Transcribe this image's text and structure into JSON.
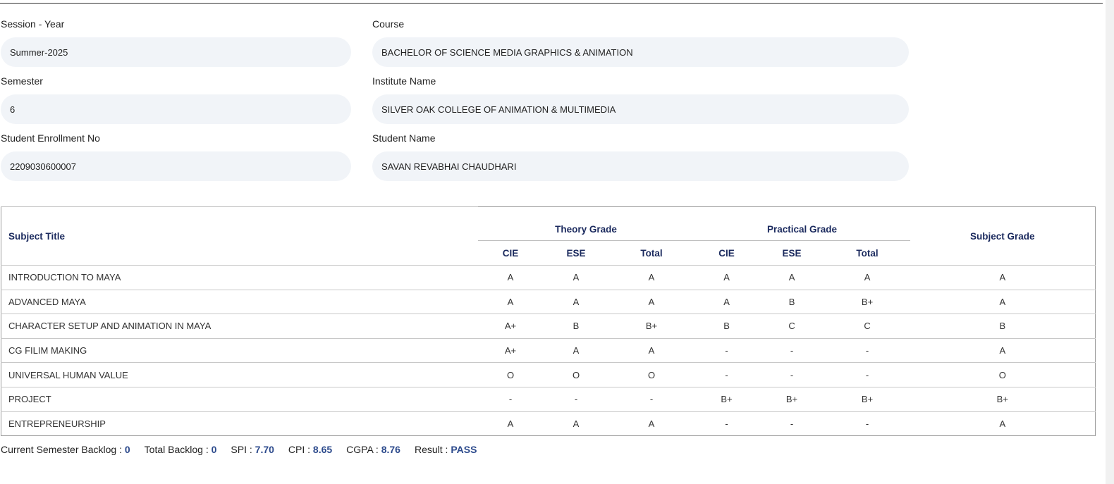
{
  "fields": {
    "session_year": {
      "label": "Session - Year",
      "value": "Summer-2025"
    },
    "course": {
      "label": "Course",
      "value": "BACHELOR OF SCIENCE MEDIA GRAPHICS & ANIMATION"
    },
    "semester": {
      "label": "Semester",
      "value": "6"
    },
    "institute": {
      "label": "Institute Name",
      "value": "SILVER OAK COLLEGE OF ANIMATION & MULTIMEDIA"
    },
    "enrollment": {
      "label": "Student Enrollment No",
      "value": "2209030600007"
    },
    "student_name": {
      "label": "Student Name",
      "value": "SAVAN REVABHAI CHAUDHARI"
    }
  },
  "table": {
    "headers": {
      "subject_title": "Subject Title",
      "theory_grade": "Theory Grade",
      "practical_grade": "Practical Grade",
      "subject_grade": "Subject Grade",
      "sub_cols": [
        "CIE",
        "ESE",
        "Total",
        "CIE",
        "ESE",
        "Total"
      ]
    },
    "rows": [
      [
        "INTRODUCTION TO MAYA",
        "A",
        "A",
        "A",
        "A",
        "A",
        "A",
        "A"
      ],
      [
        "ADVANCED MAYA",
        "A",
        "A",
        "A",
        "A",
        "B",
        "B+",
        "A"
      ],
      [
        "CHARACTER SETUP AND ANIMATION IN MAYA",
        "A+",
        "B",
        "B+",
        "B",
        "C",
        "C",
        "B"
      ],
      [
        "CG FILIM MAKING",
        "A+",
        "A",
        "A",
        "-",
        "-",
        "-",
        "A"
      ],
      [
        "UNIVERSAL HUMAN VALUE",
        "O",
        "O",
        "O",
        "-",
        "-",
        "-",
        "O"
      ],
      [
        "PROJECT",
        "-",
        "-",
        "-",
        "B+",
        "B+",
        "B+",
        "B+"
      ],
      [
        "ENTREPRENEURSHIP",
        "A",
        "A",
        "A",
        "-",
        "-",
        "-",
        "A"
      ]
    ]
  },
  "summary": {
    "current_backlog": {
      "label": "Current Semester Backlog :",
      "value": "0"
    },
    "total_backlog": {
      "label": "Total Backlog :",
      "value": "0"
    },
    "spi": {
      "label": "SPI :",
      "value": "7.70"
    },
    "cpi": {
      "label": "CPI :",
      "value": "8.65"
    },
    "cgpa": {
      "label": "CGPA :",
      "value": "8.76"
    },
    "result": {
      "label": "Result :",
      "value": "PASS"
    }
  },
  "colors": {
    "header_text": "#1b2a5e",
    "summary_value": "#2c4a8c",
    "field_bg": "#f1f4f8"
  }
}
